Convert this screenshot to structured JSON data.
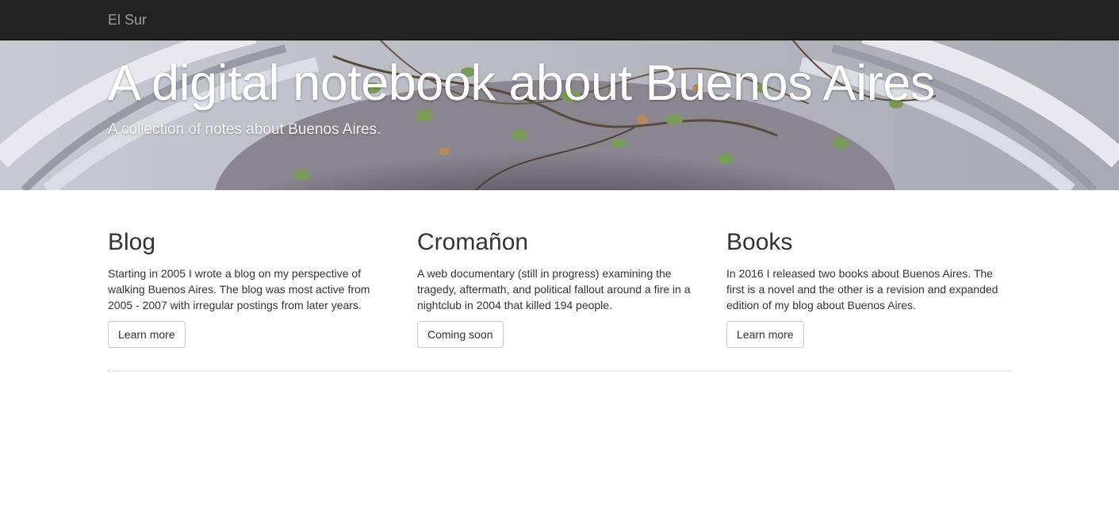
{
  "navbar": {
    "brand": "El Sur",
    "background": "#222222",
    "brand_color": "#9d9d9d"
  },
  "hero": {
    "title": "A digital notebook about Buenos Aires",
    "subtitle": "A collection of notes about Buenos Aires.",
    "background_image": "stone-arch-with-ivy-photo"
  },
  "columns": [
    {
      "heading": "Blog",
      "text": "Starting in 2005 I wrote a blog on my perspective of walking Buenos Aires. The blog was most active from 2005 - 2007 with irregular postings from later years.",
      "button_label": "Learn more"
    },
    {
      "heading": "Cromañon",
      "text": "A web documentary (still in progress) examining the tragedy, aftermath, and political fallout around a fire in a nightclub in 2004 that killed 194 people.",
      "button_label": "Coming soon"
    },
    {
      "heading": "Books",
      "text": "In 2016 I released two books about Buenos Aires. The first is a novel and the other is a revision and expanded edition of my blog about Buenos Aires.",
      "button_label": "Learn more"
    }
  ],
  "colors": {
    "text": "#333333",
    "button_border": "#cccccc",
    "divider": "#eeeeee"
  }
}
